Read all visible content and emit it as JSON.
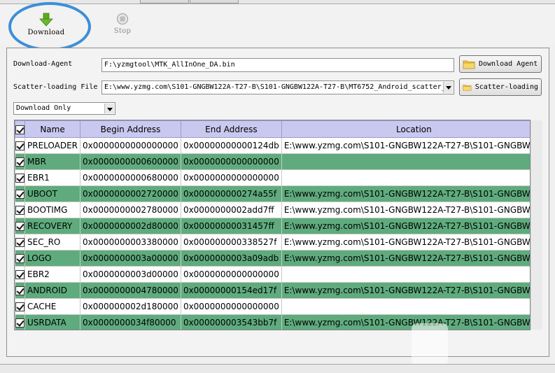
{
  "toolbar": {
    "download_label": "Download",
    "stop_label": "Stop"
  },
  "download_agent": {
    "label": "Download-Agent",
    "value": "F:\\yzmgtool\\MTK_AllInOne_DA.bin",
    "button_label": "Download Agent"
  },
  "scatter": {
    "label": "Scatter-loading File",
    "value": "E:\\www.yzmg.com\\S101-GNGBW122A-T27-B\\S101-GNGBW122A-T27-B\\MT6752_Android_scatter_",
    "button_label": "Scatter-loading"
  },
  "mode": {
    "selected": "Download Only"
  },
  "table": {
    "columns": [
      "Name",
      "Begin Address",
      "End Address",
      "Location"
    ],
    "rows": [
      {
        "checked": true,
        "name": "PRELOADER",
        "begin": "0x0000000000000000",
        "end": "0x00000000000124db",
        "location": "E:\\www.yzmg.com\\S101-GNGBW122A-T27-B\\S101-GNGBW1..."
      },
      {
        "checked": true,
        "name": "MBR",
        "begin": "0x0000000000600000",
        "end": "0x0000000000000000",
        "location": ""
      },
      {
        "checked": true,
        "name": "EBR1",
        "begin": "0x0000000000680000",
        "end": "0x0000000000000000",
        "location": ""
      },
      {
        "checked": true,
        "name": "UBOOT",
        "begin": "0x0000000002720000",
        "end": "0x000000000274a55f",
        "location": "E:\\www.yzmg.com\\S101-GNGBW122A-T27-B\\S101-GNGBW1..."
      },
      {
        "checked": true,
        "name": "BOOTIMG",
        "begin": "0x0000000002780000",
        "end": "0x0000000002add7ff",
        "location": "E:\\www.yzmg.com\\S101-GNGBW122A-T27-B\\S101-GNGBW1..."
      },
      {
        "checked": true,
        "name": "RECOVERY",
        "begin": "0x0000000002d80000",
        "end": "0x00000000031457ff",
        "location": "E:\\www.yzmg.com\\S101-GNGBW122A-T27-B\\S101-GNGBW1..."
      },
      {
        "checked": true,
        "name": "SEC_RO",
        "begin": "0x0000000003380000",
        "end": "0x000000000338527f",
        "location": "E:\\www.yzmg.com\\S101-GNGBW122A-T27-B\\S101-GNGBW1..."
      },
      {
        "checked": true,
        "name": "LOGO",
        "begin": "0x0000000003a00000",
        "end": "0x0000000003a09adb",
        "location": "E:\\www.yzmg.com\\S101-GNGBW122A-T27-B\\S101-GNGBW1..."
      },
      {
        "checked": true,
        "name": "EBR2",
        "begin": "0x0000000003d00000",
        "end": "0x0000000000000000",
        "location": ""
      },
      {
        "checked": true,
        "name": "ANDROID",
        "begin": "0x0000000004780000",
        "end": "0x00000000154ed17f",
        "location": "E:\\www.yzmg.com\\S101-GNGBW122A-T27-B\\S101-GNGBW1..."
      },
      {
        "checked": true,
        "name": "CACHE",
        "begin": "0x000000002d180000",
        "end": "0x0000000000000000",
        "location": ""
      },
      {
        "checked": true,
        "name": "USRDATA",
        "begin": "0x0000000034f80000",
        "end": "0x000000003543bb7f",
        "location": "E:\\www.yzmg.com\\S101-GNGBW122A-T27-B\\S101-GNGBW1..."
      }
    ]
  },
  "colors": {
    "header_bg": "#c9c9ef",
    "alt_row_bg": "#5fab7d",
    "highlight_ring": "#3b8fd9"
  },
  "icons": {
    "download": "download-arrow-icon",
    "stop": "stop-icon",
    "folder": "folder-icon"
  }
}
